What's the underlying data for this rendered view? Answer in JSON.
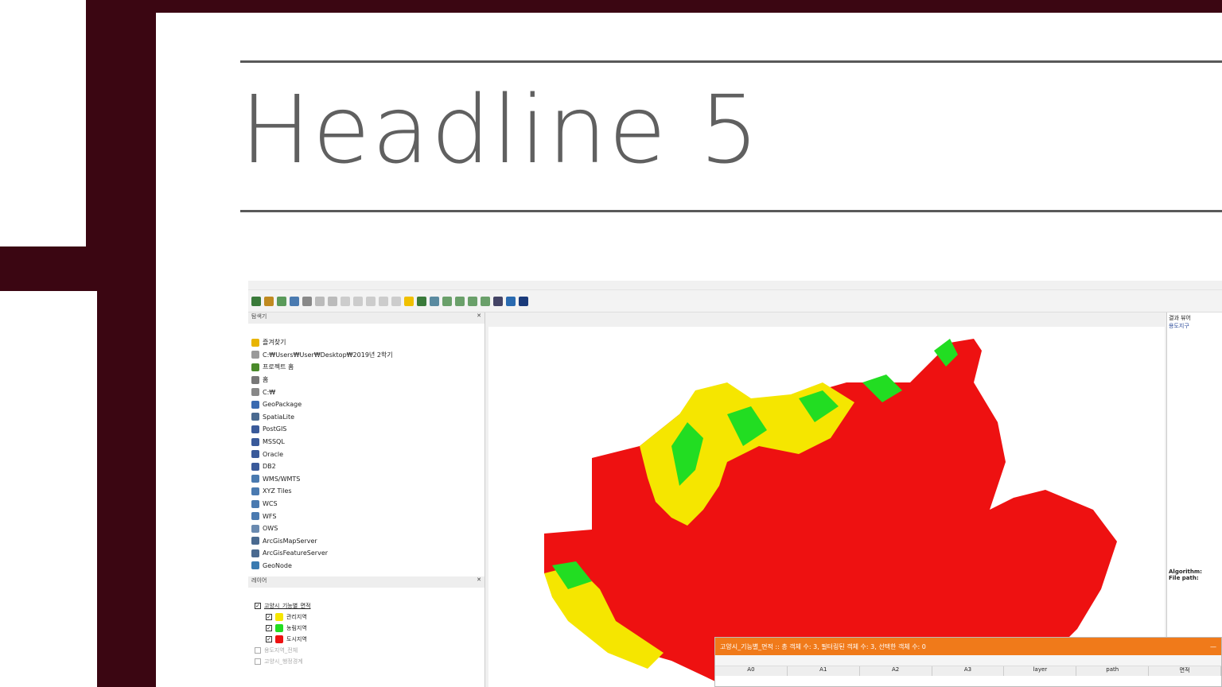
{
  "slide": {
    "headline": "Headline 5"
  },
  "qgis": {
    "browser_title": "탐색기",
    "browser_items": [
      {
        "label": "즐겨찾기",
        "icon": "star-icon",
        "color": "#e8b400"
      },
      {
        "label": "C:₩Users₩User₩Desktop₩2019년 2학기",
        "icon": "folder-icon",
        "color": "#999999"
      },
      {
        "label": "프로젝트 홈",
        "icon": "project-home-icon",
        "color": "#4a8a2a"
      },
      {
        "label": "홈",
        "icon": "home-icon",
        "color": "#777777"
      },
      {
        "label": "C:₩",
        "icon": "drive-icon",
        "color": "#888888"
      },
      {
        "label": "GeoPackage",
        "icon": "geopackage-icon",
        "color": "#3a6ab0"
      },
      {
        "label": "SpatiaLite",
        "icon": "spatialite-icon",
        "color": "#4a6a90"
      },
      {
        "label": "PostGIS",
        "icon": "postgis-icon",
        "color": "#3a5a9a"
      },
      {
        "label": "MSSQL",
        "icon": "mssql-icon",
        "color": "#3a5a9a"
      },
      {
        "label": "Oracle",
        "icon": "oracle-icon",
        "color": "#3a5a9a"
      },
      {
        "label": "DB2",
        "icon": "db2-icon",
        "color": "#3a5a9a"
      },
      {
        "label": "WMS/WMTS",
        "icon": "wms-icon",
        "color": "#4a7ab0"
      },
      {
        "label": "XYZ Tiles",
        "icon": "xyz-icon",
        "color": "#4a7ab0"
      },
      {
        "label": "WCS",
        "icon": "wcs-icon",
        "color": "#4a7ab0"
      },
      {
        "label": "WFS",
        "icon": "wfs-icon",
        "color": "#4a7ab0"
      },
      {
        "label": "OWS",
        "icon": "ows-icon",
        "color": "#6a8ab0"
      },
      {
        "label": "ArcGisMapServer",
        "icon": "arcgis-map-icon",
        "color": "#4a6a90"
      },
      {
        "label": "ArcGisFeatureServer",
        "icon": "arcgis-feature-icon",
        "color": "#4a6a90"
      },
      {
        "label": "GeoNode",
        "icon": "geonode-icon",
        "color": "#3a7ab0"
      }
    ],
    "layers_title": "레이어",
    "layer_group": "고양시_기능별_면적",
    "layer_classes": [
      {
        "label": "관리지역",
        "color": "#f5e600"
      },
      {
        "label": "농림지역",
        "color": "#22dd22"
      },
      {
        "label": "도시지역",
        "color": "#ee1111"
      }
    ],
    "layer_extra": [
      "용도지역_전체",
      "고양시_행정경계"
    ],
    "results_title": "결과 뷰어",
    "results_item": "용도지구",
    "algorithm_label": "Algorithm:",
    "filepath_label": "File path:",
    "attribute_title": "고양시_기능별_면적 :: 총 객체 수: 3, 필터링된 객체 수: 3, 선택한 객체 수: 0",
    "attribute_columns": [
      "A0",
      "A1",
      "A2",
      "A3",
      "layer",
      "path",
      "면적"
    ],
    "map_colors": {
      "urban": "#ee1111",
      "management": "#f5e600",
      "agri": "#22dd22"
    }
  }
}
